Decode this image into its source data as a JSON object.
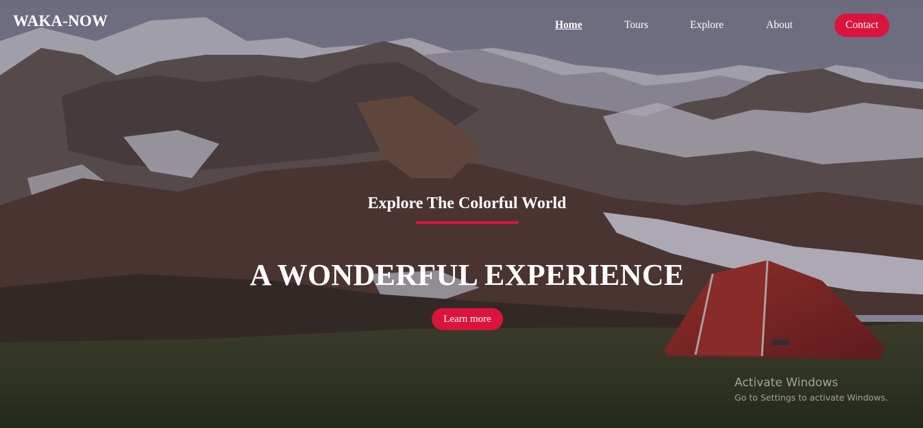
{
  "brand": {
    "logo_text": "WAKA-NOW"
  },
  "nav": {
    "items": [
      {
        "label": "Home",
        "active": true
      },
      {
        "label": "Tours",
        "active": false
      },
      {
        "label": "Explore",
        "active": false
      },
      {
        "label": "About",
        "active": false
      }
    ],
    "contact_label": "Contact"
  },
  "hero": {
    "subtitle": "Explore The Colorful World",
    "headline": "A WONDERFUL EXPERIENCE",
    "cta_label": "Learn more",
    "background_image": "mountain-landscape-with-red-tent"
  },
  "watermark": {
    "title": "Activate Windows",
    "subtitle": "Go to Settings to activate Windows."
  },
  "colors": {
    "accent": "#dc143c",
    "text": "#ffffff"
  }
}
